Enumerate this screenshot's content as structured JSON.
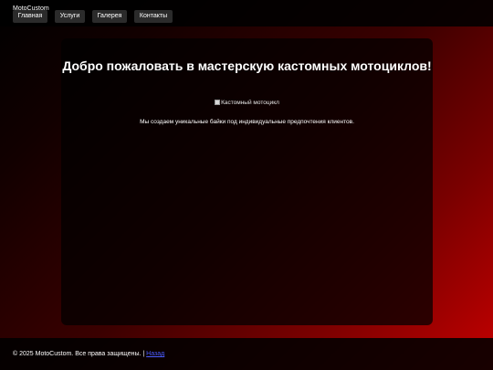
{
  "header": {
    "logo": "MotoCustom",
    "nav": [
      {
        "label": "Главная"
      },
      {
        "label": "Услуги"
      },
      {
        "label": "Галерея"
      },
      {
        "label": "Контакты"
      }
    ]
  },
  "main": {
    "title": "Добро пожаловать в мастерскую кастомных мотоциклов!",
    "image_alt": "Кастомный мотоцикл",
    "intro": "Мы создаем уникальные байки под индивидуальные предпочтения клиентов."
  },
  "footer": {
    "copyright": "© 2025 MotoCustom. Все права защищены.",
    "separator": " | ",
    "link": "Назад"
  },
  "colors": {
    "background_gradient_start": "#000000",
    "background_gradient_end": "#c40000",
    "nav_button_bg": "#2b2b2b",
    "footer_link": "#4a5cff"
  }
}
